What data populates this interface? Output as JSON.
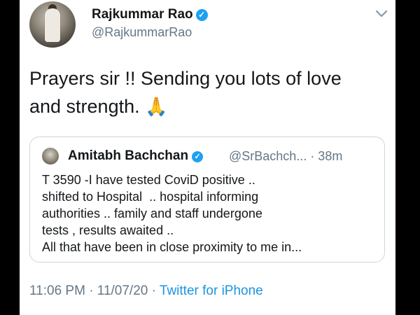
{
  "tweet": {
    "author": {
      "display_name": "Rajkummar Rao",
      "handle": "@RajkummarRao",
      "verified": true
    },
    "text_line1": "Prayers sir !! Sending you lots of love",
    "text_line2": "and strength.",
    "emoji": "🙏",
    "menu_icon": "chevron-down-icon",
    "timestamp": "11:06 PM · 11/07/20 · ",
    "source": "Twitter for iPhone"
  },
  "quoted_tweet": {
    "author": {
      "display_name": "Amitabh Bachchan",
      "verified": true
    },
    "meta": "@SrBachch... · 38m",
    "lines": [
      "T 3590 -I have tested CoviD positive ..",
      "shifted to Hospital  .. hospital informing",
      "authorities .. family and staff undergone",
      "tests , results awaited ..",
      "All that have been in close proximity to me in..."
    ]
  },
  "colors": {
    "text": "#14171a",
    "secondary": "#657786",
    "link": "#1b95e0",
    "verified": "#1da1f2",
    "border": "#ccd6dd"
  }
}
